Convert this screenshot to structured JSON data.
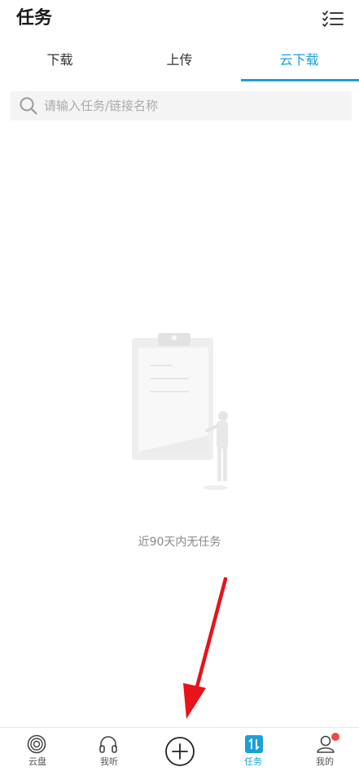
{
  "header": {
    "title": "任务",
    "checklist_icon": "checklist-icon"
  },
  "tabs": [
    {
      "label": "下载",
      "active": false
    },
    {
      "label": "上传",
      "active": false
    },
    {
      "label": "云下载",
      "active": true
    }
  ],
  "search": {
    "placeholder": "请输入任务/链接名称",
    "icon": "search-icon"
  },
  "empty_state": {
    "message": "近90天内无任务",
    "illustration": "clipboard-person-illustration"
  },
  "annotation": {
    "type": "red-arrow",
    "points_to": "add-button",
    "color": "#e8131b"
  },
  "bottom_nav": {
    "items": [
      {
        "label": "云盘",
        "icon": "cloud-disk-icon",
        "active": false
      },
      {
        "label": "我听",
        "icon": "headphones-icon",
        "active": false
      },
      {
        "label": "",
        "icon": "plus-circle-icon",
        "active": false
      },
      {
        "label": "任务",
        "icon": "transfer-icon",
        "active": true
      },
      {
        "label": "我的",
        "icon": "person-icon",
        "active": false,
        "badge": "red-dot"
      }
    ]
  },
  "colors": {
    "accent": "#1aa0d8",
    "badge": "#ef4b3c",
    "text_primary": "#1a1a1a",
    "text_muted": "#888888"
  }
}
